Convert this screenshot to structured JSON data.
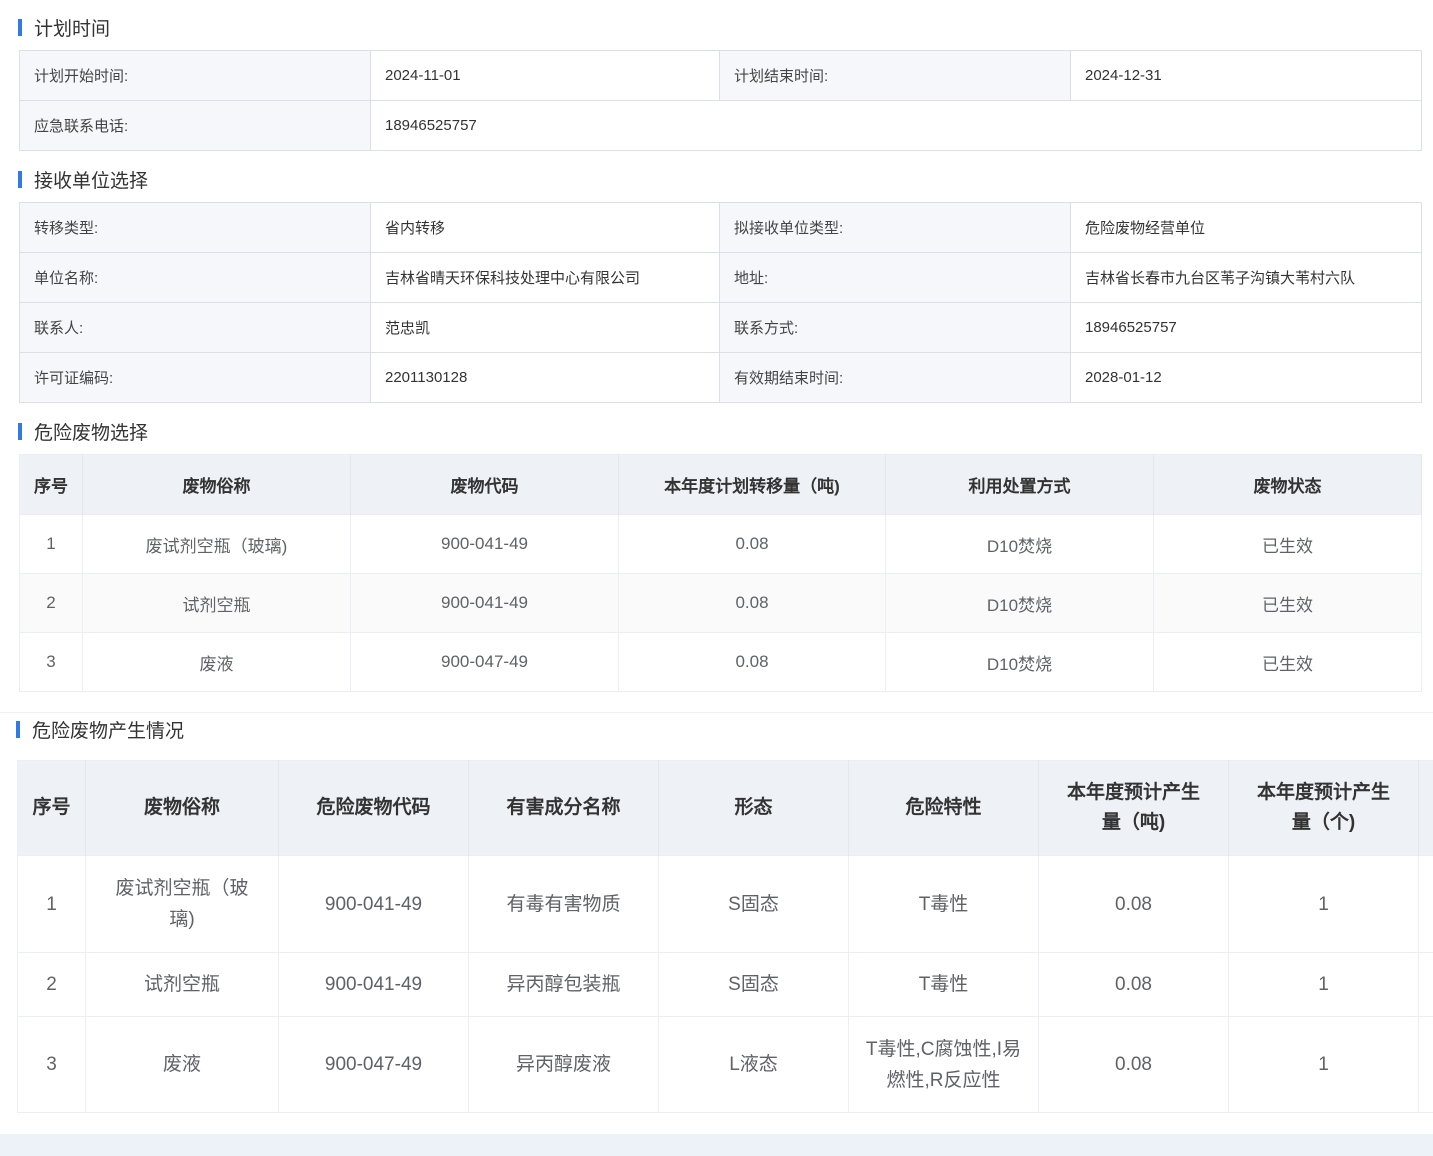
{
  "plan_section": {
    "title": "计划时间",
    "start_label": "计划开始时间:",
    "start_value": "2024-11-01",
    "end_label": "计划结束时间:",
    "end_value": "2024-12-31",
    "phone_label": "应急联系电话:",
    "phone_value": "18946525757"
  },
  "receiver_section": {
    "title": "接收单位选择",
    "transfer_type_label": "转移类型:",
    "transfer_type_value": "省内转移",
    "receiver_type_label": "拟接收单位类型:",
    "receiver_type_value": "危险废物经营单位",
    "unit_name_label": "单位名称:",
    "unit_name_value": "吉林省晴天环保科技处理中心有限公司",
    "address_label": "地址:",
    "address_value": "吉林省长春市九台区苇子沟镇大苇村六队",
    "contact_label": "联系人:",
    "contact_value": "范忠凯",
    "contact_method_label": "联系方式:",
    "contact_method_value": "18946525757",
    "license_label": "许可证编码:",
    "license_value": "2201130128",
    "expiry_label": "有效期结束时间:",
    "expiry_value": "2028-01-12"
  },
  "waste_selection": {
    "title": "危险废物选择",
    "headers": [
      "序号",
      "废物俗称",
      "废物代码",
      "本年度计划转移量（吨)",
      "利用处置方式",
      "废物状态"
    ],
    "rows": [
      [
        "1",
        "废试剂空瓶（玻璃)",
        "900-041-49",
        "0.08",
        "D10焚烧",
        "已生效"
      ],
      [
        "2",
        "试剂空瓶",
        "900-041-49",
        "0.08",
        "D10焚烧",
        "已生效"
      ],
      [
        "3",
        "废液",
        "900-047-49",
        "0.08",
        "D10焚烧",
        "已生效"
      ]
    ],
    "status_color": "#2e9a2e"
  },
  "waste_production": {
    "title": "危险废物产生情况",
    "headers": [
      "序号",
      "废物俗称",
      "危险废物代码",
      "有害成分名称",
      "形态",
      "危险特性",
      "本年度预计产生量（吨)",
      "本年度预计产生量（个)"
    ],
    "rows": [
      [
        "1",
        "废试剂空瓶（玻璃)",
        "900-041-49",
        "有毒有害物质",
        "S固态",
        "T毒性",
        "0.08",
        "1"
      ],
      [
        "2",
        "试剂空瓶",
        "900-041-49",
        "异丙醇包装瓶",
        "S固态",
        "T毒性",
        "0.08",
        "1"
      ],
      [
        "3",
        "废液",
        "900-047-49",
        "异丙醇废液",
        "L液态",
        "T毒性,C腐蚀性,I易燃性,R反应性",
        "0.08",
        "1"
      ]
    ]
  },
  "colors": {
    "accent": "#2f7ae5",
    "label_bg": "#f5f7fa",
    "header_bg": "#eef1f5"
  }
}
